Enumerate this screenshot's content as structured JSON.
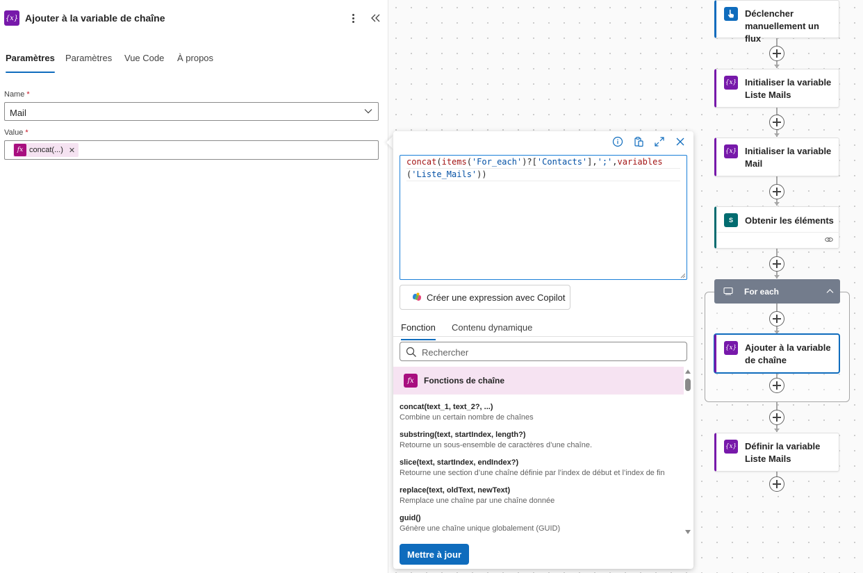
{
  "panel": {
    "title": "Ajouter à la variable de chaîne",
    "tabs": [
      "Paramètres",
      "Paramètres",
      "Vue Code",
      "À propos"
    ],
    "name_label": "Name",
    "name_required": "*",
    "name_value": "Mail",
    "value_label": "Value",
    "value_required": "*",
    "value_token": "concat(...)",
    "token_remove": "✕"
  },
  "expression": {
    "code_line1": {
      "fn1": "concat",
      "p1": "(",
      "fn2": "items",
      "p2": "(",
      "s1": "'For_each'",
      "p3": ")?[",
      "s2": "'Contacts'",
      "p4": "],",
      "s3": "';'",
      "p5": ",",
      "fn3": "variables"
    },
    "code_line2": {
      "p1": "(",
      "s1": "'Liste_Mails'",
      "p2": "))"
    },
    "copilot_label": "Créer une expression avec Copilot",
    "tabs": [
      "Fonction",
      "Contenu dynamique"
    ],
    "search_placeholder": "Rechercher",
    "category": "Fonctions de chaîne",
    "functions": [
      {
        "sig": "concat(text_1, text_2?, ...)",
        "desc": "Combine un certain nombre de chaînes"
      },
      {
        "sig": "substring(text, startIndex, length?)",
        "desc": "Retourne un sous-ensemble de caractères d’une chaîne."
      },
      {
        "sig": "slice(text, startIndex, endIndex?)",
        "desc": "Retourne une section d’une chaîne définie par l’index de début et l’index de fin"
      },
      {
        "sig": "replace(text, oldText, newText)",
        "desc": "Remplace une chaîne par une chaîne donnée"
      },
      {
        "sig": "guid()",
        "desc": "Génère une chaîne unique globalement (GUID)"
      }
    ],
    "update_label": "Mettre à jour"
  },
  "flow": {
    "steps": [
      {
        "label": "Déclencher manuellement un flux",
        "icon": "hand-touch-icon",
        "accent": "#0f6cbd"
      },
      {
        "label": "Initialiser la variable Liste Mails",
        "icon": "variable-icon",
        "accent": "#7719aa"
      },
      {
        "label": "Initialiser la variable Mail",
        "icon": "variable-icon",
        "accent": "#7719aa"
      },
      {
        "label": "Obtenir les éléments",
        "icon": "sharepoint-icon",
        "accent": "#036c70"
      },
      {
        "label": "Ajouter à la variable de chaîne",
        "icon": "variable-icon",
        "accent": "#7719aa"
      },
      {
        "label": "Définir la variable Liste Mails",
        "icon": "variable-icon",
        "accent": "#7719aa"
      }
    ],
    "foreach_label": "For each"
  },
  "colors": {
    "accent": "#0f6cbd",
    "variable": "#7719aa",
    "expression_fn": "#a80e7f",
    "foreach_header": "#737c8c"
  }
}
